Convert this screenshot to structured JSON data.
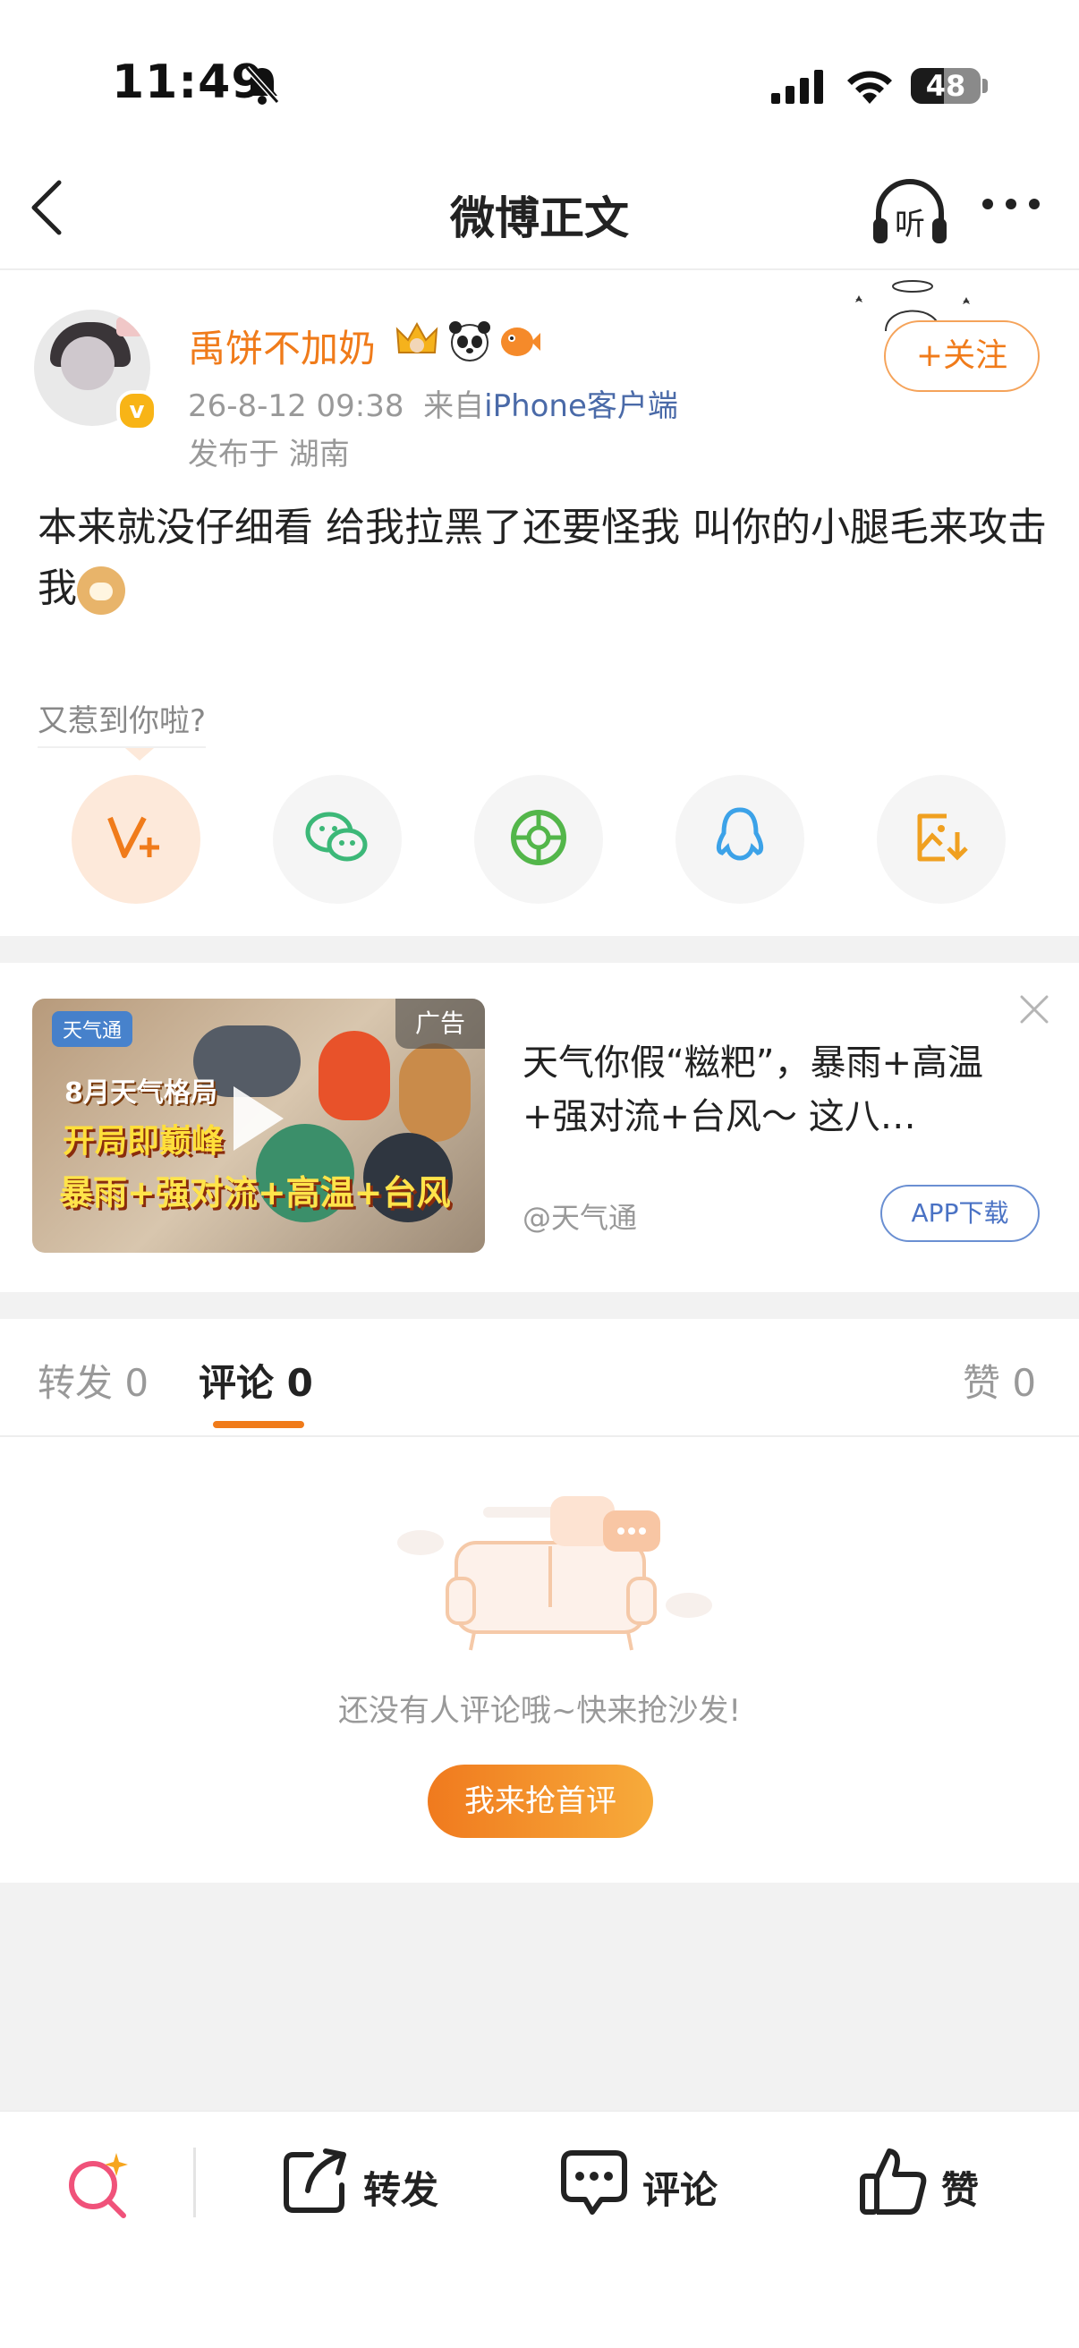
{
  "status_bar": {
    "time": "11:49",
    "battery": "48",
    "battery_level": 0.48
  },
  "nav": {
    "title": "微博正文",
    "listen_label": "听"
  },
  "post": {
    "username": "禹饼不加奶",
    "timestamp": "26-8-12 09:38",
    "source_prefix": "来自",
    "source": "iPhone客户端",
    "location": "发布于 湖南",
    "follow_label": "+关注",
    "verified_mark": "v",
    "text": "本来就没仔细看 给我拉黑了还要怪我 叫你的小腿毛来攻击我"
  },
  "share": {
    "prompt": "又惹到你啦?",
    "buttons": [
      "vplus-icon",
      "wechat-icon",
      "moments-icon",
      "qq-icon",
      "save-image-icon"
    ]
  },
  "ad": {
    "tag": "广告",
    "brand": "天气通",
    "thumb_line1": "8月天气格局",
    "thumb_line2": "开局即巅峰",
    "thumb_line3": "暴雨+强对流+高温+台风",
    "title": "天气你假“糍粑”，暴雨+高温+强对流+台风～ 这八…",
    "source": "@天气通",
    "cta": "APP下载"
  },
  "tabs": {
    "repost": "转发 0",
    "comment": "评论 0",
    "like": "赞 0"
  },
  "empty_state": {
    "message": "还没有人评论哦~快来抢沙发!",
    "button": "我来抢首评"
  },
  "bottom_bar": {
    "repost": "转发",
    "comment": "评论",
    "like": "赞"
  },
  "colors": {
    "accent": "#f07b1a",
    "link": "#4a6aa8",
    "muted": "#999999",
    "gap": "#f2f2f2"
  }
}
